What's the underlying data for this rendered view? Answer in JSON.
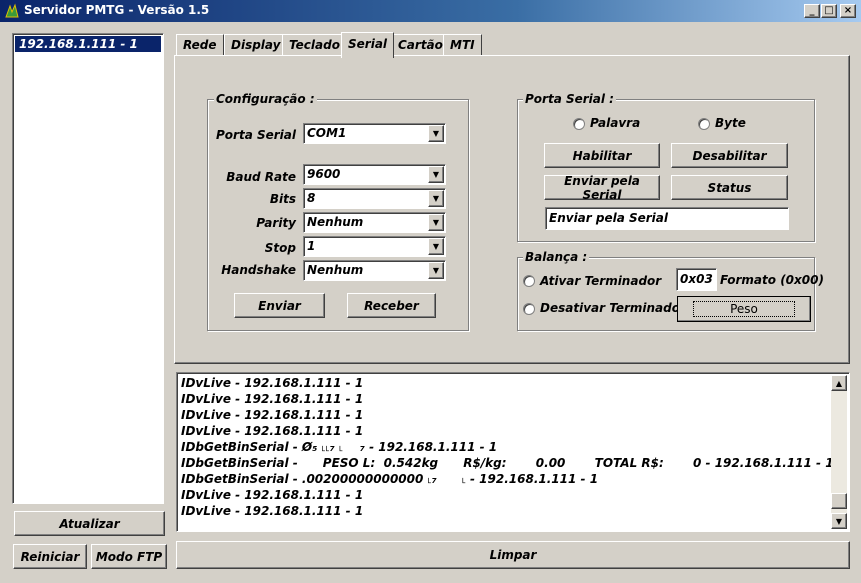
{
  "window": {
    "title": "Servidor PMTG - Versão 1.5",
    "controls": [
      "_",
      "□",
      "×"
    ]
  },
  "hosts": [
    "192.168.1.111 - 1"
  ],
  "tabs": [
    "Rede",
    "Display",
    "Teclado",
    "Serial",
    "Cartão",
    "MTI"
  ],
  "active_tab": "Serial",
  "config": {
    "title": "Configuração :",
    "porta_label": "Porta Serial",
    "porta_value": "COM1",
    "baud_label": "Baud Rate",
    "baud_value": "9600",
    "bits_label": "Bits",
    "bits_value": "8",
    "parity_label": "Parity",
    "parity_value": "Nenhum",
    "stop_label": "Stop",
    "stop_value": "1",
    "handshake_label": "Handshake",
    "handshake_value": "Nenhum",
    "enviar": "Enviar",
    "receber": "Receber"
  },
  "porta_serial": {
    "title": "Porta Serial :",
    "palavra": "Palavra",
    "byte": "Byte",
    "habilitar": "Habilitar",
    "desabilitar": "Desabilitar",
    "enviar_serial": "Enviar pela Serial",
    "status": "Status",
    "input_value": "Enviar pela Serial"
  },
  "balanca": {
    "title": "Balança :",
    "ativar": "Ativar Terminador",
    "desativar": "Desativar Terminador",
    "terminador_value": "0x03",
    "formato": "Formato (0x00)",
    "peso": "Peso"
  },
  "log_lines": [
    "IDvLive - 192.168.1.111 - 1",
    "IDvLive - 192.168.1.111 - 1",
    "IDvLive - 192.168.1.111 - 1",
    "IDvLive - 192.168.1.111 - 1",
    "IDbGetBinSerial - Ø₅ ˪˪₇ ˪    ₇ - 192.168.1.111 - 1",
    "IDbGetBinSerial -      PESO L:  0.542kg      R$/kg:       0.00       TOTAL R$:       0 - 192.168.1.111 - 1",
    "IDbGetBinSerial - .00200000000000 ˪₇      ˪ - 192.168.1.111 - 1",
    "IDvLive - 192.168.1.111 - 1",
    "IDvLive - 192.168.1.111 - 1"
  ],
  "buttons": {
    "atualizar": "Atualizar",
    "reiniciar": "Reiniciar",
    "modo_ftp": "Modo FTP",
    "limpar": "Limpar"
  }
}
